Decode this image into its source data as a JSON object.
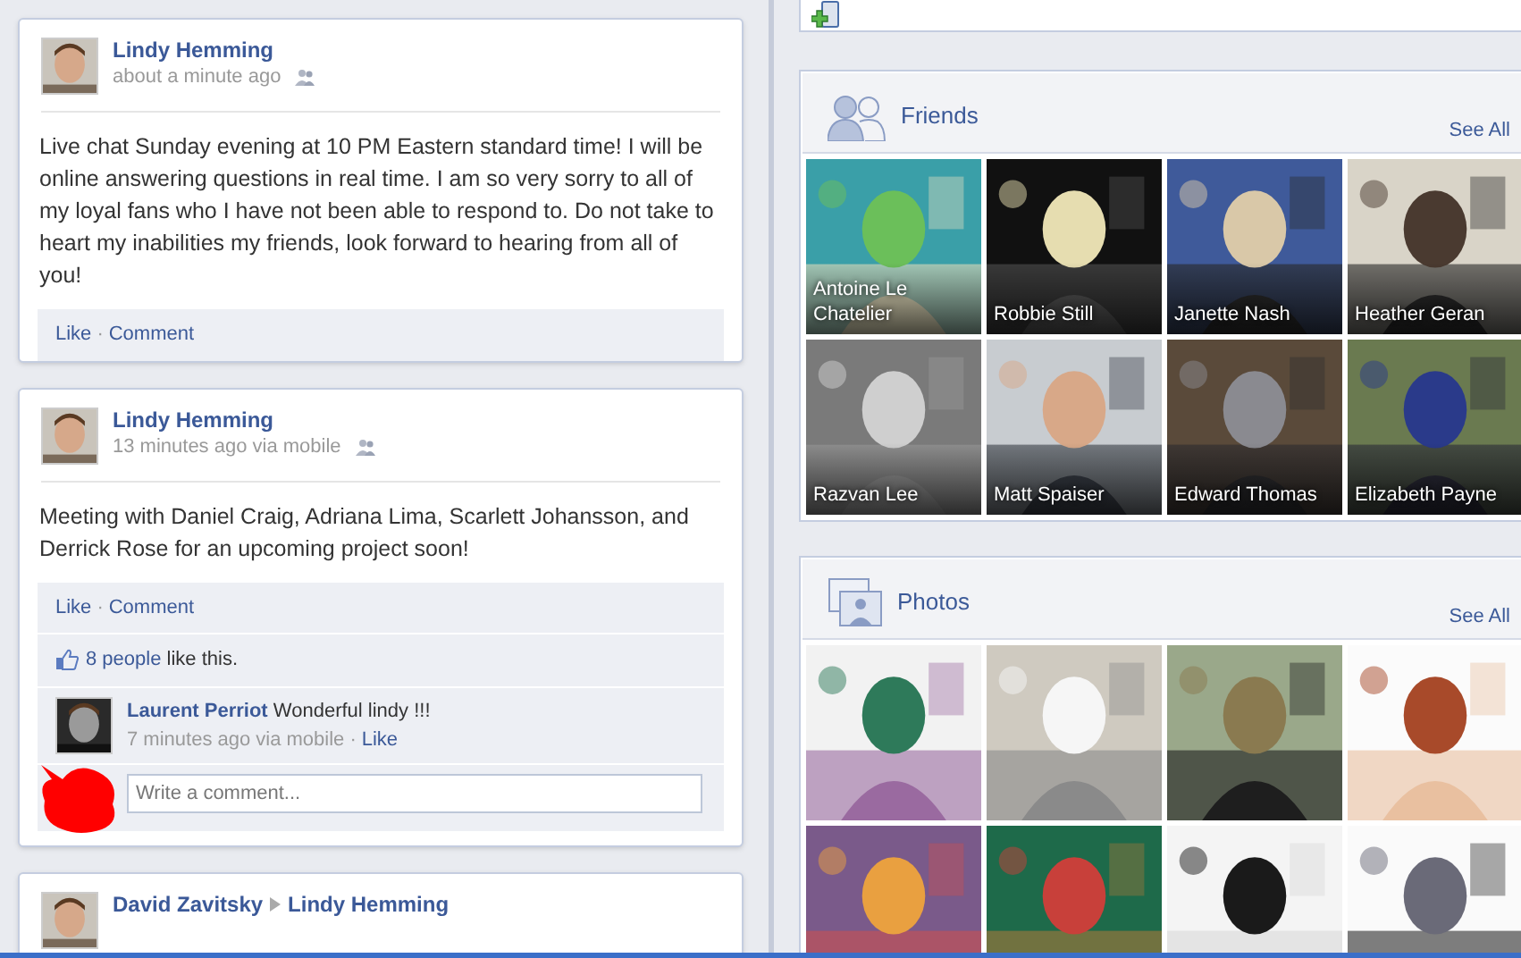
{
  "separator": "·",
  "posts": [
    {
      "author": "Lindy Hemming",
      "time": "about a minute ago",
      "text": "Live chat Sunday evening at 10 PM Eastern standard time! I will be online answering questions in real time. I am so very sorry to all of my loyal fans who I have not been able to respond to. Do not take to heart my inabilities my friends, look forward to hearing from all of you!",
      "actions": [
        "Like",
        "Comment"
      ]
    },
    {
      "author": "Lindy Hemming",
      "time": "13 minutes ago via mobile",
      "text": "Meeting with Daniel Craig, Adriana Lima, Scarlett Johansson, and Derrick Rose for an upcoming project soon!",
      "actions": [
        "Like",
        "Comment"
      ],
      "likes": {
        "count": "8 people",
        "suffix": "like this."
      },
      "comments": [
        {
          "author": "Laurent Perriot",
          "text": "Wonderful lindy !!!",
          "time": "7 minutes ago via mobile",
          "like": "Like"
        }
      ],
      "comment_placeholder": "Write a comment..."
    },
    {
      "author": "David Zavitsky",
      "target": "Lindy Hemming"
    }
  ],
  "friends": {
    "title": "Friends",
    "see_all": "See All",
    "items": [
      {
        "name": "Antoine Le Chatelier"
      },
      {
        "name": "Robbie Still"
      },
      {
        "name": "Janette Nash"
      },
      {
        "name": "Heather Geran"
      },
      {
        "name": "Razvan Lee"
      },
      {
        "name": "Matt Spaiser"
      },
      {
        "name": "Edward Thomas"
      },
      {
        "name": "Elizabeth Payne"
      }
    ]
  },
  "photos": {
    "title": "Photos",
    "see_all": "See All"
  }
}
